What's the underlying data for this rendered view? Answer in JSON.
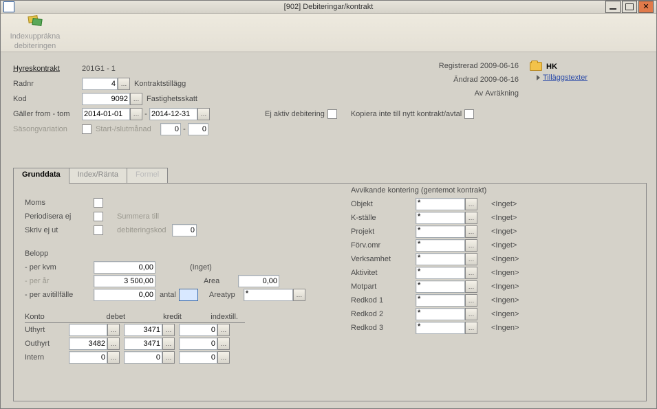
{
  "window": {
    "title": "[902]  Debiteringar/kontrakt"
  },
  "ribbon": {
    "indexuppr_l1": "Indexuppräkna",
    "indexuppr_l2": "debiteringen"
  },
  "meta": {
    "reg_label": "Registrerad",
    "reg_date": "2009-06-16",
    "chg_label": "Ändrad",
    "chg_date": "2009-06-16",
    "av_label": "Av",
    "av_value": "Avräkning"
  },
  "side": {
    "hk": "HK",
    "tillaggstexter": "Tilläggstexter"
  },
  "form": {
    "hyreskontrakt_label": "Hyreskontrakt",
    "hyreskontrakt_value": "201G1 - 1",
    "radnr_label": "Radnr",
    "radnr_value": "4",
    "kontraktstillagg": "Kontraktstillägg",
    "kod_label": "Kod",
    "kod_value": "9092",
    "fastighetsskatt": "Fastighetsskatt",
    "galler_label": "Gäller from - tom",
    "galler_from": "2014-01-01",
    "galler_to": "2014-12-31",
    "galler_sep": "-",
    "ej_aktiv": "Ej aktiv debitering",
    "kopiera_inte": "Kopiera inte till nytt kontrakt/avtal",
    "sasong_label": "Säsongvariation",
    "start_slut_label": "Start-/slutmånad",
    "sasong_v1": "0",
    "sasong_v2": "0",
    "sasong_sep": "-"
  },
  "tabs": {
    "grunddata": "Grunddata",
    "index": "Index/Ränta",
    "formel": "Formel"
  },
  "gd": {
    "moms": "Moms",
    "periodisera": "Periodisera ej",
    "skrivejut": "Skriv ej ut",
    "summera_l1": "Summera till",
    "summera_l2": "debiteringskod",
    "summera_val": "0",
    "belopp": "Belopp",
    "per_kvm": "- per kvm",
    "per_kvm_v": "0,00",
    "inget": "(Inget)",
    "per_ar": "- per år",
    "per_ar_v": "3 500,00",
    "area_lbl": "Area",
    "area_v": "0,00",
    "per_avi": "- per avitillfälle",
    "per_avi_v": "0,00",
    "antal": "antal",
    "areatyp": "Areatyp",
    "konto": "Konto",
    "debet": "debet",
    "kredit": "kredit",
    "indextill": "indextill.",
    "uthyrt": "Uthyrt",
    "outhyrt": "Outhyrt",
    "intern": "Intern",
    "r_uthyrt_debet": "",
    "r_uthyrt_kredit": "3471",
    "r_uthyrt_idx": "0",
    "r_outhyrt_debet": "3482",
    "r_outhyrt_kredit": "3471",
    "r_outhyrt_idx": "0",
    "r_intern_debet": "0",
    "r_intern_kredit": "0",
    "r_intern_idx": "0"
  },
  "avk": {
    "heading": "Avvikande kontering (gentemot kontrakt)",
    "rows": [
      {
        "label": "Objekt",
        "desc": "<Inget>"
      },
      {
        "label": "K-ställe",
        "desc": "<Inget>"
      },
      {
        "label": "Projekt",
        "desc": "<Inget>"
      },
      {
        "label": "Förv.omr",
        "desc": "<Inget>"
      },
      {
        "label": "Verksamhet",
        "desc": "<Ingen>"
      },
      {
        "label": "Aktivitet",
        "desc": "<Ingen>"
      },
      {
        "label": "Motpart",
        "desc": "<Ingen>"
      },
      {
        "label": "Redkod 1",
        "desc": "<Ingen>"
      },
      {
        "label": "Redkod 2",
        "desc": "<Ingen>"
      },
      {
        "label": "Redkod 3",
        "desc": "<Ingen>"
      }
    ]
  }
}
